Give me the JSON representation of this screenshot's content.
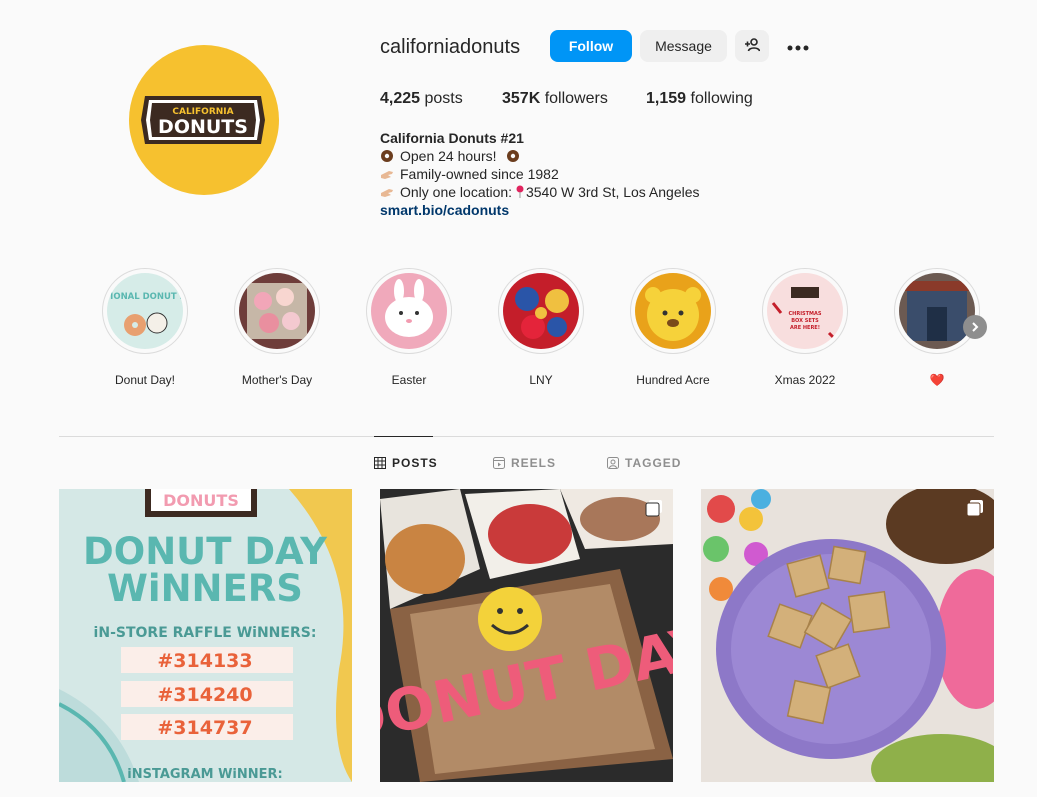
{
  "profile": {
    "username": "californiadonuts",
    "avatar_logo_top": "CALIFORNIA",
    "avatar_logo_main": "DONUTS",
    "buttons": {
      "follow": "Follow",
      "message": "Message"
    },
    "stats": {
      "posts_count": "4,225",
      "posts_label": "posts",
      "followers_count": "357K",
      "followers_label": "followers",
      "following_count": "1,159",
      "following_label": "following"
    },
    "bio": {
      "name": "California Donuts #21",
      "line1": "Open 24 hours!",
      "line2": "Family-owned since 1982",
      "line3": "Only one location: ",
      "line3_address": "3540 W 3rd St, Los Angeles",
      "link": "smart.bio/cadonuts"
    }
  },
  "highlights": [
    {
      "label": "Donut Day!",
      "image_text": "NATIONAL DONUT DAY"
    },
    {
      "label": "Mother's Day"
    },
    {
      "label": "Easter"
    },
    {
      "label": "LNY"
    },
    {
      "label": "Hundred Acre"
    },
    {
      "label": "Xmas 2022",
      "image_text": "CHRISTMAS BOX SETS ARE HERE!"
    },
    {
      "label": "❤️"
    }
  ],
  "tabs": [
    {
      "label": "POSTS",
      "icon": "grid-icon",
      "active": true
    },
    {
      "label": "REELS",
      "icon": "reels-icon",
      "active": false
    },
    {
      "label": "TAGGED",
      "icon": "tagged-icon",
      "active": false
    }
  ],
  "posts": [
    {
      "title_line1": "DONUT DAY",
      "title_line2": "WiNNERS",
      "subtitle": "iN-STORE RAFFLE WiNNERS:",
      "numbers": [
        "#314133",
        "#314240",
        "#314737"
      ],
      "footer": "iNSTAGRAM WiNNER:",
      "logo_text": "DONUTS"
    },
    {
      "donut_text": "DONUT DAY"
    },
    {}
  ],
  "colors": {
    "accent": "#0095f6",
    "avatar_bg": "#f6c12f",
    "link": "#00376b"
  }
}
